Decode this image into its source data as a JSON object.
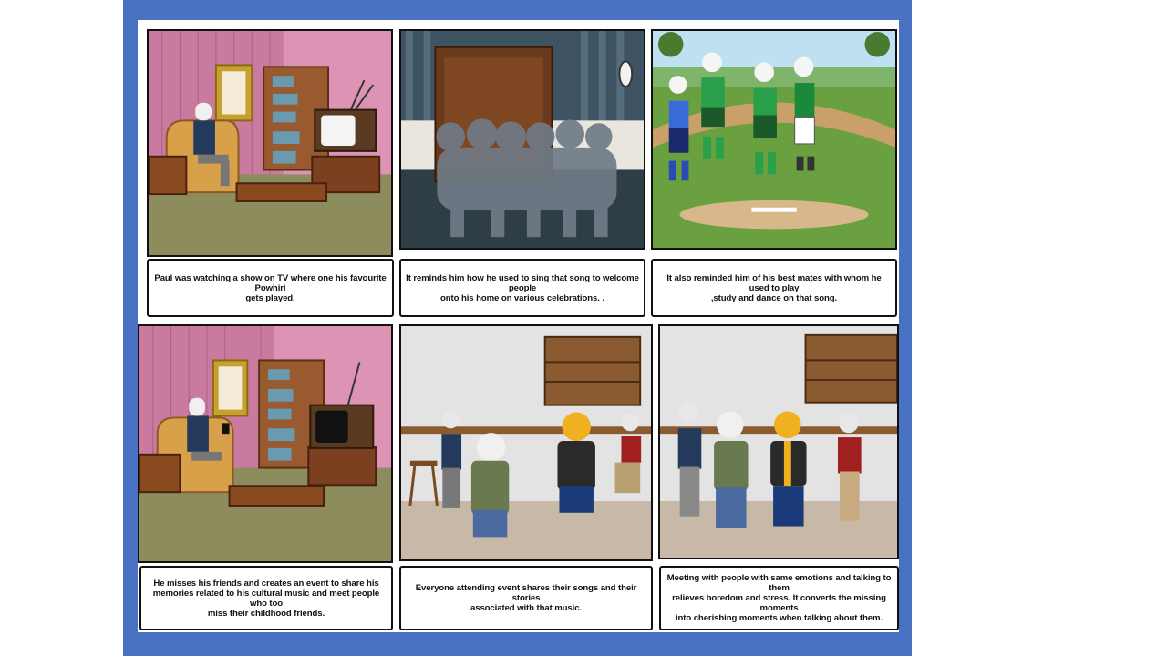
{
  "storyboard": {
    "panels": [
      {
        "caption": "Paul was watching a show on TV where one his favourite Powhiri\ngets played."
      },
      {
        "caption": "It reminds him how he used to sing that song to welcome people\nonto his home on various celebrations. ."
      },
      {
        "caption": "It also reminded him of his best mates with whom he used to play\n,study and dance on that song."
      },
      {
        "caption": "He misses his friends and creates an event to share his\nmemories  related to his cultural music and meet people who too\nmiss their childhood friends."
      },
      {
        "caption": "Everyone attending event shares their songs and their stories\nassociated with that music."
      },
      {
        "caption": "Meeting with people with same emotions and talking to them\nrelieves  boredom and stress. It converts the missing moments\ninto cherishing moments when talking about them."
      }
    ]
  },
  "colors": {
    "frame": "#4a72c4",
    "wall_pink": "#c97a9e",
    "floor_green": "#8c8c5c",
    "dark_room": "#3f5463",
    "grass": "#6aa040",
    "hall_wall": "#e3e3e3",
    "hall_floor": "#c8b8a8"
  }
}
